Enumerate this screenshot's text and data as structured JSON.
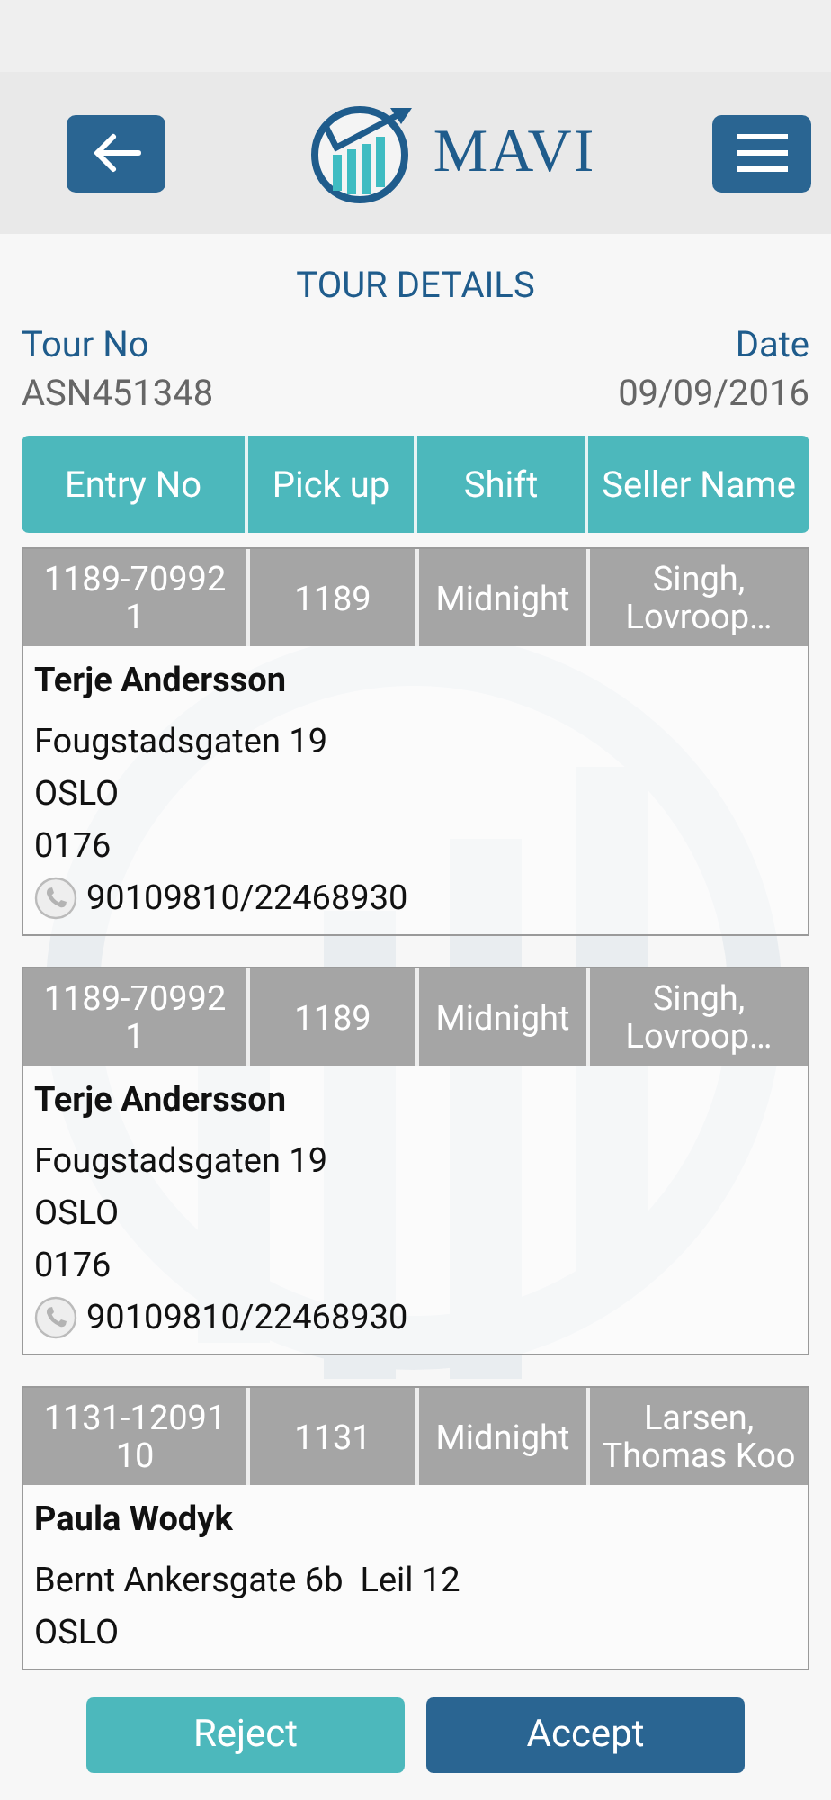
{
  "header": {
    "brand": "MAVI"
  },
  "title": "TOUR DETAILS",
  "tour": {
    "label": "Tour No",
    "value": "ASN451348"
  },
  "date": {
    "label": "Date",
    "value": "09/09/2016"
  },
  "columns": [
    "Entry No",
    "Pick up",
    "Shift",
    "Seller Name"
  ],
  "entries": [
    {
      "entry_no": "1189-709921",
      "pickup": "1189",
      "shift": "Midnight",
      "seller": "Singh, Lovroop…",
      "name": "Terje Andersson",
      "address_lines": [
        "Fougstadsgaten 19",
        "OSLO",
        "0176"
      ],
      "phone": "90109810/22468930"
    },
    {
      "entry_no": "1189-709921",
      "pickup": "1189",
      "shift": "Midnight",
      "seller": "Singh, Lovroop…",
      "name": "Terje Andersson",
      "address_lines": [
        "Fougstadsgaten 19",
        "OSLO",
        "0176"
      ],
      "phone": "90109810/22468930"
    },
    {
      "entry_no": "1131-1209110",
      "pickup": "1131",
      "shift": "Midnight",
      "seller": "Larsen, Thomas Koo",
      "name": "Paula Wodyk",
      "address_lines": [
        "Bernt Ankersgate 6b  Leil 12",
        "OSLO"
      ]
    }
  ],
  "buttons": [
    {
      "label": "Reject",
      "kind": "secondary"
    },
    {
      "label": "Accept",
      "kind": "primary"
    }
  ]
}
